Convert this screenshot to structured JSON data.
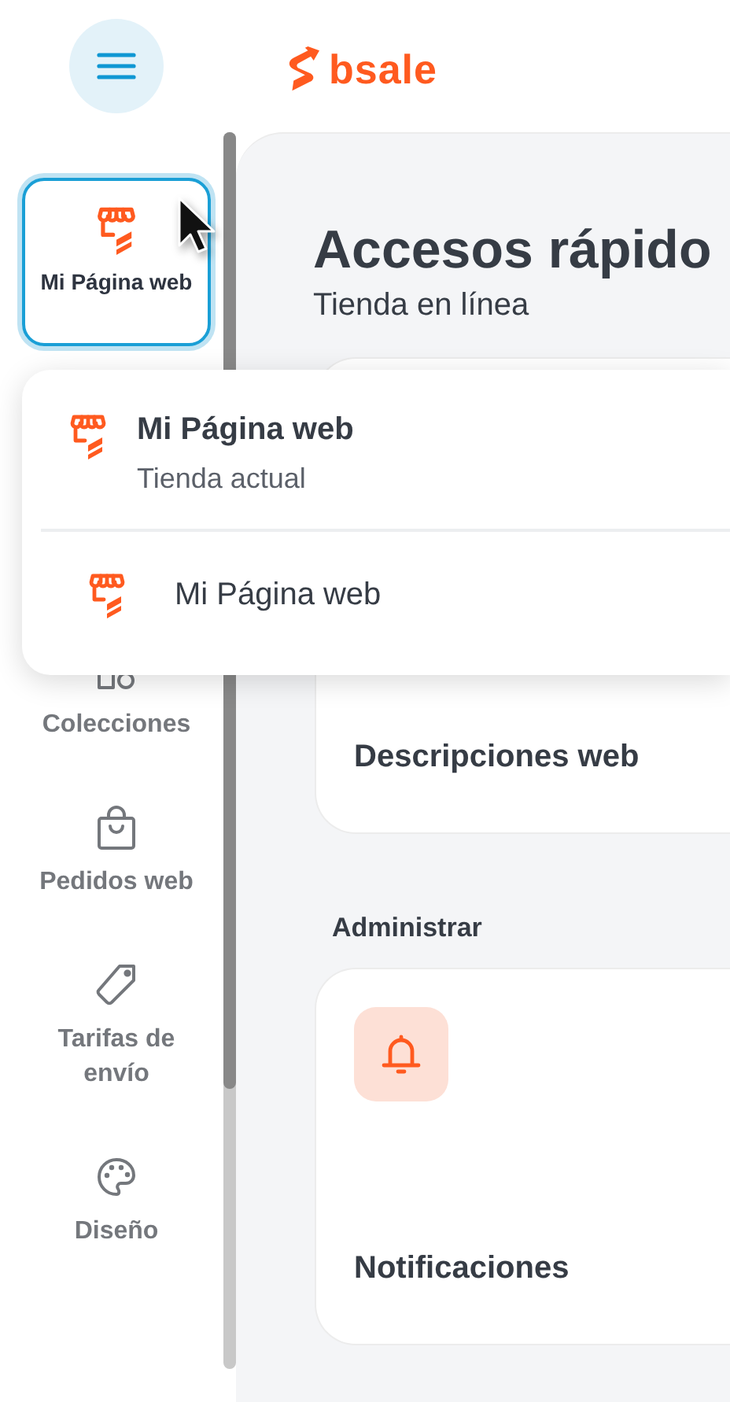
{
  "header": {
    "logo": "bsale"
  },
  "sidebar": {
    "items": [
      {
        "label": "Mi Página web",
        "selected": true
      },
      {
        "label": "Colecciones",
        "selected": false
      },
      {
        "label": "Pedidos web",
        "selected": false
      },
      {
        "label": "Tarifas de envío",
        "selected": false
      },
      {
        "label": "Diseño",
        "selected": false
      }
    ]
  },
  "main": {
    "title": "Accesos rápido",
    "subtitle": "Tienda en línea",
    "cards": [
      {
        "label": "Descripciones web"
      }
    ],
    "sections": [
      {
        "heading": "Administrar",
        "cards": [
          {
            "label": "Notificaciones"
          }
        ]
      }
    ]
  },
  "store_menu": {
    "current": {
      "title": "Mi Página web",
      "subtitle": "Tienda actual"
    },
    "items": [
      {
        "label": "Mi Página web"
      }
    ]
  }
}
